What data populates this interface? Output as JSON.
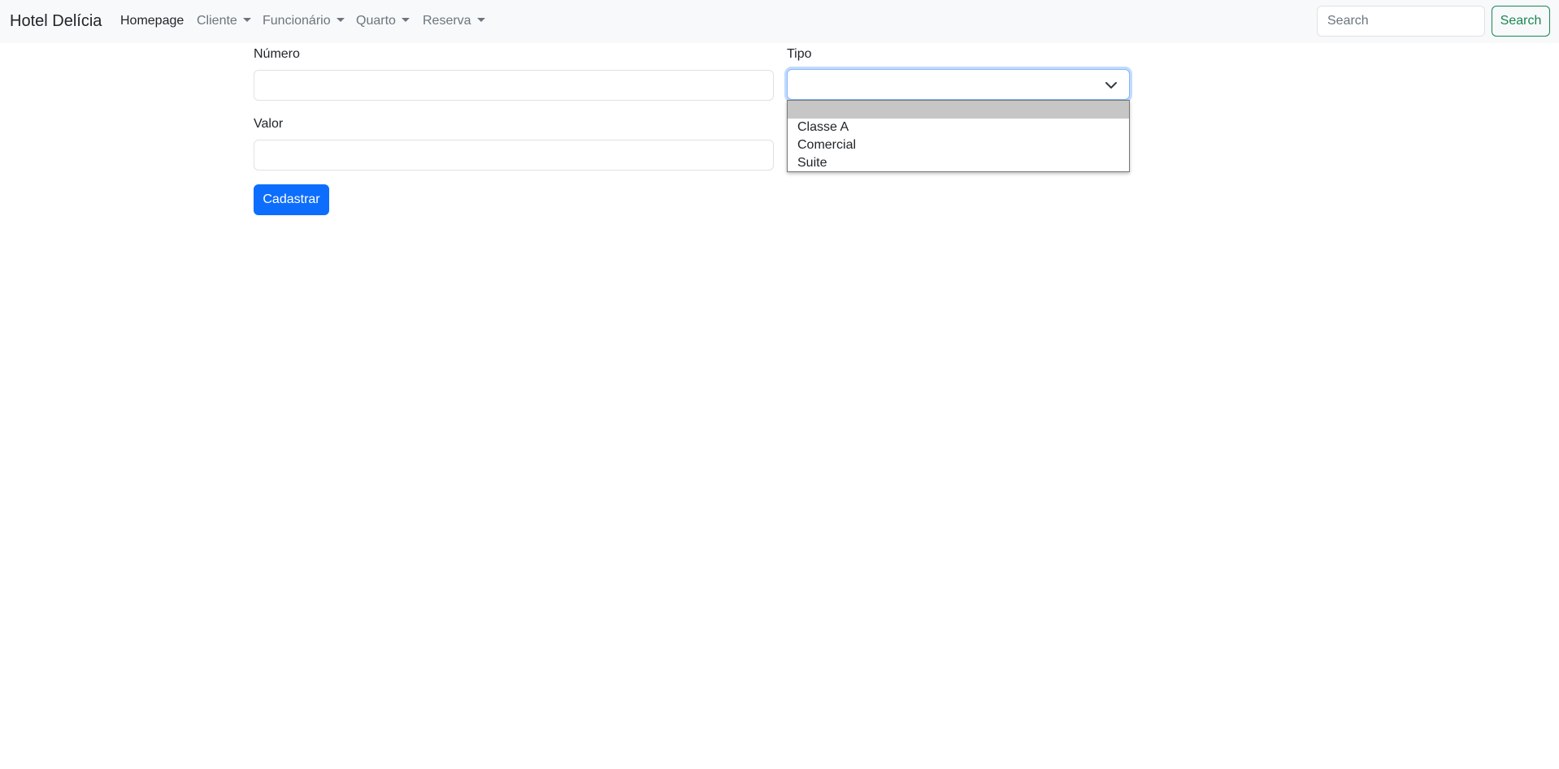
{
  "navbar": {
    "brand": "Hotel Delícia",
    "links": [
      {
        "label": "Homepage",
        "dropdown": false
      },
      {
        "label": "Cliente",
        "dropdown": true
      },
      {
        "label": "Funcionário",
        "dropdown": true
      },
      {
        "label": "Quarto",
        "dropdown": true
      },
      {
        "label": "Reserva",
        "dropdown": true
      }
    ],
    "search": {
      "placeholder": "Search",
      "value": "",
      "button_label": "Search"
    }
  },
  "form": {
    "numero": {
      "label": "Número",
      "value": ""
    },
    "tipo": {
      "label": "Tipo",
      "value": "",
      "options": [
        "",
        "Classe A",
        "Comercial",
        "Suite"
      ]
    },
    "valor": {
      "label": "Valor",
      "value": ""
    },
    "submit_label": "Cadastrar"
  },
  "colors": {
    "navbar_bg": "#f8f9fa",
    "primary": "#0d6efd",
    "success": "#198754",
    "focus_border": "#86b7fe",
    "option_highlight": "#c6c6c6"
  },
  "icons": {
    "select_arrow": "chevron-down-icon",
    "nav_dropdown": "caret-down-icon"
  }
}
